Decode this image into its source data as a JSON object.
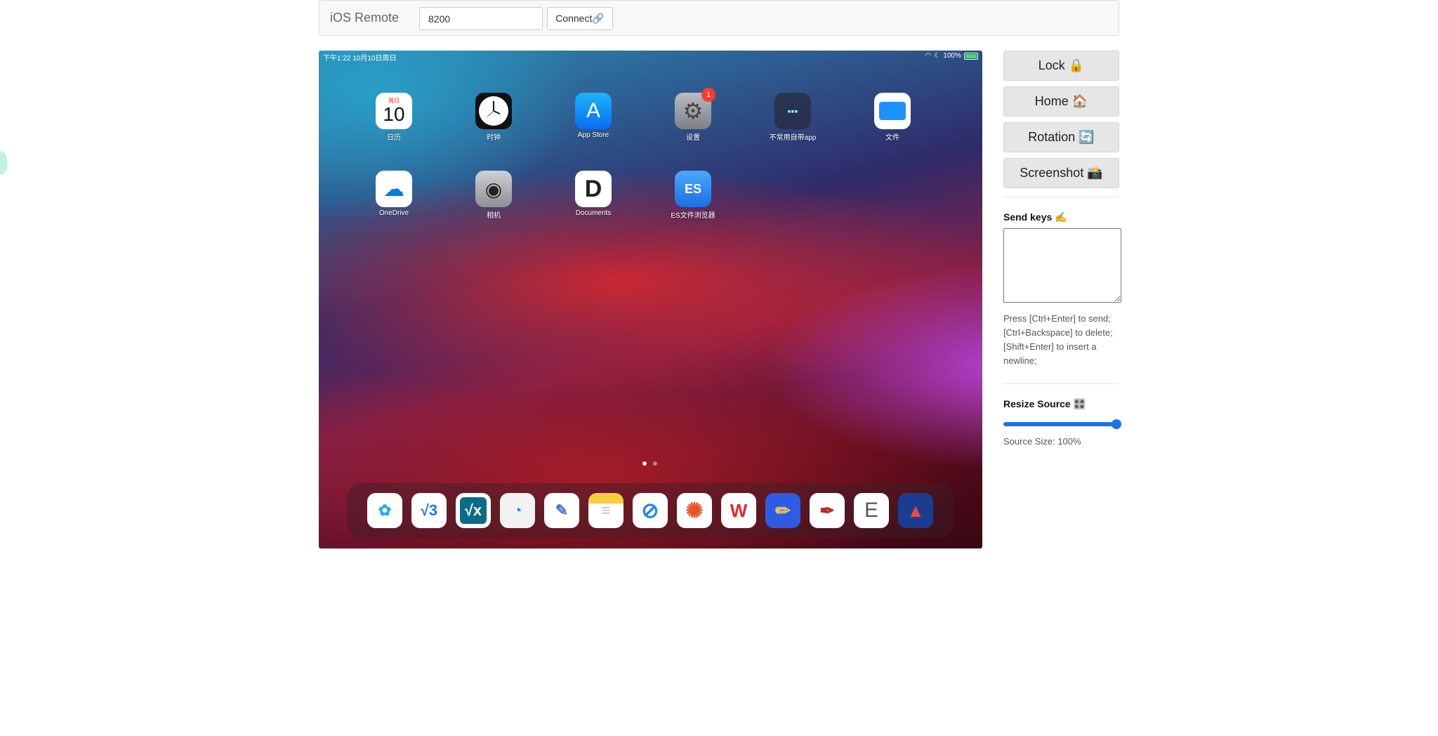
{
  "navbar": {
    "brand": "iOS Remote",
    "port_value": "8200",
    "connect_label": "Connect🔗"
  },
  "device": {
    "status_left": "下午1:22  10月10日周日",
    "status_battery": "100%",
    "apps": [
      {
        "label": "日历",
        "icon": "calendar-icon",
        "weekday": "周日",
        "day": "10"
      },
      {
        "label": "时钟",
        "icon": "clock-icon"
      },
      {
        "label": "App Store",
        "icon": "app-store-icon"
      },
      {
        "label": "设置",
        "icon": "settings-icon",
        "badge": "1"
      },
      {
        "label": "不常用自带app",
        "icon": "folder-icon"
      },
      {
        "label": "文件",
        "icon": "files-icon"
      },
      {
        "label": "OneDrive",
        "icon": "onedrive-icon"
      },
      {
        "label": "相机",
        "icon": "camera-icon"
      },
      {
        "label": "Documents",
        "icon": "documents-icon"
      },
      {
        "label": "ES文件浏览器",
        "icon": "es-file-explorer-icon"
      }
    ],
    "dock_apps": [
      {
        "icon": "baidu-netdisk-icon",
        "glyph": "✿"
      },
      {
        "icon": "mathstudio-icon",
        "glyph": "√3"
      },
      {
        "icon": "calculator-vx-icon",
        "glyph": "√x"
      },
      {
        "icon": "progress-ring-icon",
        "glyph": "◔"
      },
      {
        "icon": "goodnotes-icon",
        "glyph": "✎"
      },
      {
        "icon": "notes-icon",
        "glyph": "≡"
      },
      {
        "icon": "safari-icon",
        "glyph": "⊘"
      },
      {
        "icon": "photos-icon",
        "glyph": "✺"
      },
      {
        "icon": "wps-office-icon",
        "glyph": "W"
      },
      {
        "icon": "pencil-app-icon",
        "glyph": "✏"
      },
      {
        "icon": "marker-app-icon",
        "glyph": "✒"
      },
      {
        "icon": "e-app-icon",
        "glyph": "E"
      },
      {
        "icon": "rocket-app-icon",
        "glyph": "▲"
      }
    ]
  },
  "side": {
    "lock_label": "Lock 🔒",
    "home_label": "Home 🏠",
    "rotation_label": "Rotation 🔄",
    "screenshot_label": "Screenshot 📸",
    "send_keys_label": "Send keys ✍️",
    "send_keys_help": "Press [Ctrl+Enter] to send; [Ctrl+Backspace] to delete; [Shift+Enter] to insert a newline;",
    "resize_label": "Resize Source 🎛️",
    "resize_value_pct": 100,
    "source_size_text": "Source Size: 100%"
  }
}
